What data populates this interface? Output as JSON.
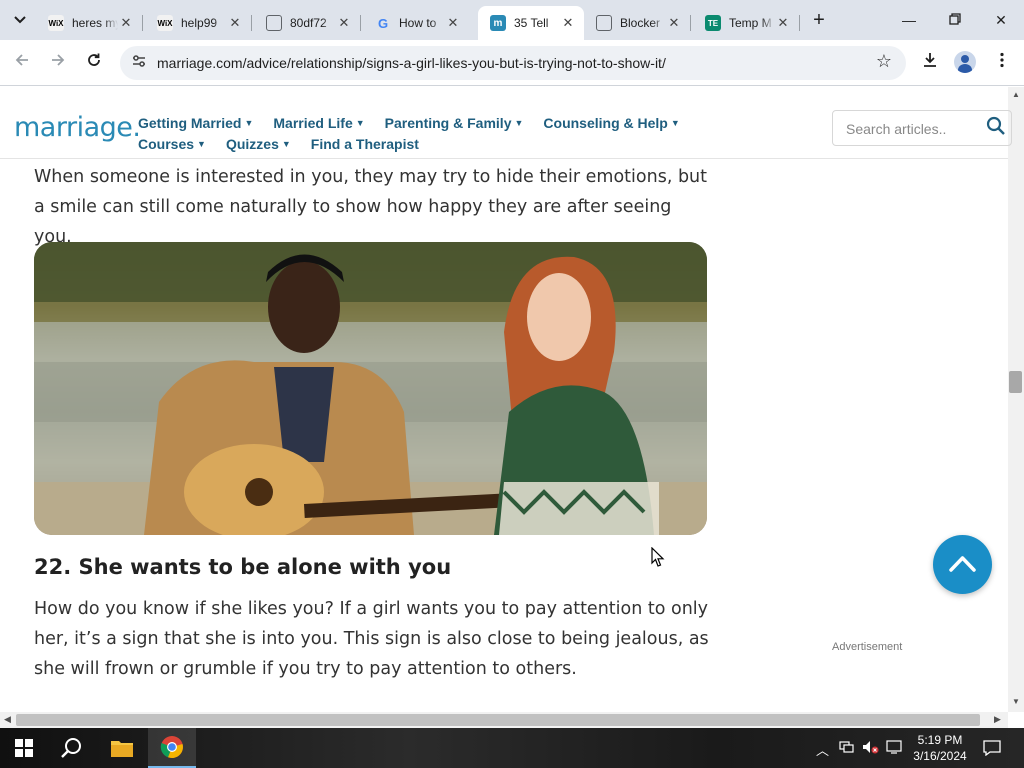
{
  "browser": {
    "tabs": [
      {
        "title": "heres my",
        "icon": "wix-icon",
        "fav_text": "WiX"
      },
      {
        "title": "help99",
        "icon": "wix-icon",
        "fav_text": "WiX"
      },
      {
        "title": "80df72",
        "icon": "globe-icon",
        "fav_text": ""
      },
      {
        "title": "How to",
        "icon": "google-icon",
        "fav_text": "G"
      },
      {
        "title": "35 Tell",
        "icon": "marriage-icon",
        "fav_text": "m",
        "active": true
      },
      {
        "title": "Blocker",
        "icon": "globe-icon",
        "fav_text": ""
      },
      {
        "title": "Temp M",
        "icon": "temp-mail-icon",
        "fav_text": "TE"
      }
    ],
    "url": "marriage.com/advice/relationship/signs-a-girl-likes-you-but-is-trying-not-to-show-it/"
  },
  "site": {
    "logo": "marriage.com",
    "nav": [
      {
        "label": "Getting Married",
        "dropdown": true
      },
      {
        "label": "Married Life",
        "dropdown": true
      },
      {
        "label": "Parenting & Family",
        "dropdown": true
      },
      {
        "label": "Counseling & Help",
        "dropdown": true
      },
      {
        "label": "Courses",
        "dropdown": true
      },
      {
        "label": "Quizzes",
        "dropdown": true
      },
      {
        "label": "Find a Therapist",
        "dropdown": false
      }
    ],
    "search_placeholder": "Search articles.."
  },
  "article": {
    "intro": "When someone is interested in you, they may try to hide their emotions, but a smile can still come naturally to show how happy they are after seeing you.",
    "heading": "22. She wants to be alone with you",
    "body": "How do you know if she likes you? If a girl wants you to pay attention to only her, it’s a sign that she is into you. This sign is also close to being jealous, as she will frown or grumble if you try to pay attention to others.",
    "ad_label": "Advertisement"
  },
  "taskbar": {
    "time": "5:19 PM",
    "date": "3/16/2024"
  },
  "colors": {
    "brand": "#2a8ab5",
    "nav_text": "#1f5e7f",
    "scroll_top_button": "#1a8ec7"
  }
}
